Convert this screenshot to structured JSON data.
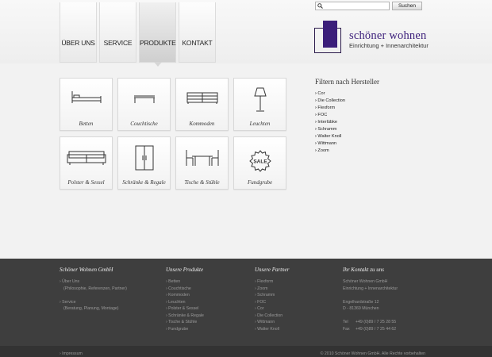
{
  "nav": {
    "tabs": [
      {
        "label": "ÜBER UNS"
      },
      {
        "label": "SERVICE"
      },
      {
        "label": "PRODUKTE"
      },
      {
        "label": "KONTAKT"
      }
    ]
  },
  "search": {
    "placeholder": "",
    "button_label": "Suchen"
  },
  "logo": {
    "title": "schöner wohnen",
    "subtitle": "Einrichtung + Innenarchitektur"
  },
  "categories": [
    {
      "label": "Betten",
      "icon": "bed-icon"
    },
    {
      "label": "Couchtische",
      "icon": "coffee-table-icon"
    },
    {
      "label": "Kommoden",
      "icon": "dresser-icon"
    },
    {
      "label": "Leuchten",
      "icon": "lamp-icon"
    },
    {
      "label": "Polster & Sessel",
      "icon": "sofa-icon"
    },
    {
      "label": "Schränke & Regale",
      "icon": "wardrobe-icon"
    },
    {
      "label": "Tische & Stühle",
      "icon": "table-chairs-icon"
    },
    {
      "label": "Fundgrube",
      "icon": "sale-icon",
      "badge": "SALE"
    }
  ],
  "filter": {
    "title": "Filtern nach Hersteller",
    "items": [
      "Cor",
      "Die Collection",
      "Flexform",
      "FOC",
      "Interlübke",
      "Schramm",
      "Walter Knoll",
      "Wittmann",
      "Zoom"
    ]
  },
  "footer": {
    "company": {
      "title": "Schöner Wohnen GmbH",
      "lines": [
        "Über Uns",
        "(Philosophie, Referenzen, Partner)",
        "",
        "Service",
        "(Beratung, Planung, Montage)"
      ]
    },
    "products": {
      "title": "Unsere Produkte",
      "items": [
        "Betten",
        "Couchtische",
        "Kommoden",
        "Leuchten",
        "Polster & Sessel",
        "Schränke & Regale",
        "Tische & Stühle",
        "Fundgrube"
      ]
    },
    "partners": {
      "title": "Unsere Partner",
      "items": [
        "Flexform",
        "Zoom",
        "Schramm",
        "FOC",
        "Cor",
        "Die Collection",
        "Wittmann",
        "Walter Knoll"
      ]
    },
    "contact": {
      "title": "Ihr Kontakt zu uns",
      "company": "Schöner Wohnen GmbH",
      "tagline": "Einrichtung + Innenarchitektur",
      "street": "Engelhardstraße 12",
      "city": "D - 81369 München",
      "tel_label": "Tel",
      "tel": "+49 (0)89 / 7 25 28 55",
      "fax_label": "Fax",
      "fax": "+49 (0)89 / 7 25 44 62"
    },
    "impressum": "Impressum",
    "copyright": "© 2010 Schöner Wohnen GmbH. Alle Rechte vorbehalten"
  },
  "colors": {
    "brand": "#3b1e7a",
    "footer_bg": "#3e3e3e",
    "page_bg": "#f2f2f2"
  }
}
